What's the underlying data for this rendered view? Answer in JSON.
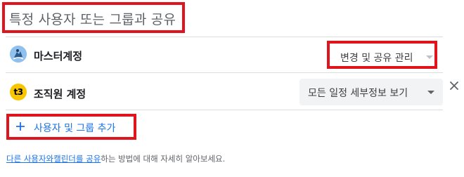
{
  "share": {
    "title": "특정 사용자 또는 그룹과 공유"
  },
  "users": [
    {
      "name": "마스터계정",
      "avatar_icon": "user-avatar-photo-icon",
      "permission": "변경 및 공유 관리",
      "permission_disabled": true
    },
    {
      "name": "조직원 계정",
      "avatar_icon": "user-avatar-t3-icon",
      "avatar_text": "t3",
      "permission": "모든 일정 세부정보 보기",
      "permission_disabled": false
    }
  ],
  "add_button": {
    "label": "사용자 및 그룹 추가"
  },
  "footer": {
    "link1": "다른 사용자와",
    "link2": "캘린더를 공유",
    "suffix": "하는 방법에 대해 자세히 알아보세요."
  },
  "colors": {
    "accent": "#1a73e8",
    "highlight_border": "#e0141d",
    "avatar_t3": "#f7c600"
  }
}
